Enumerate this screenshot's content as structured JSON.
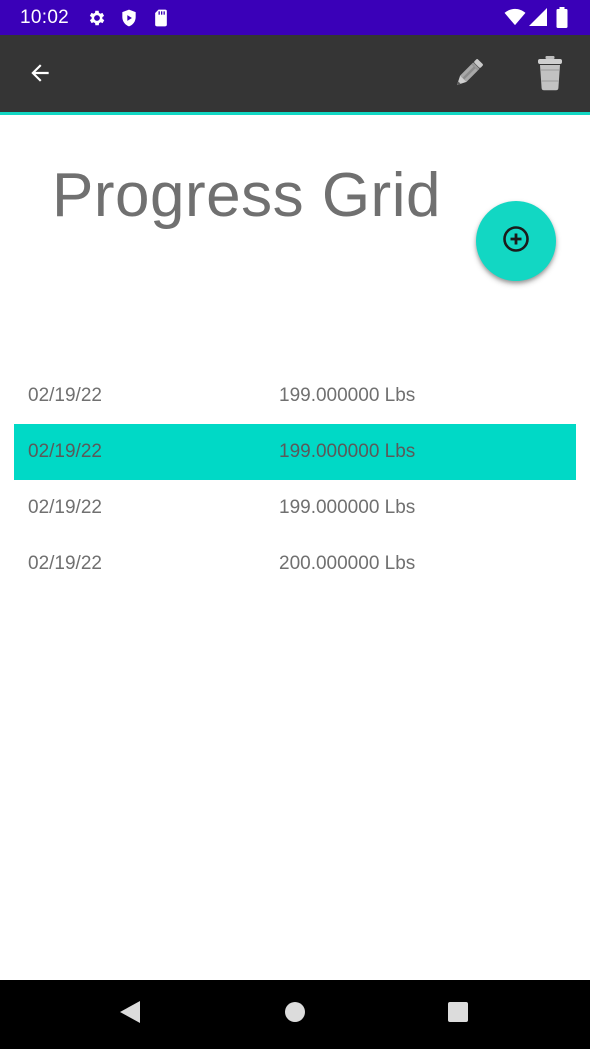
{
  "status_bar": {
    "time": "10:02",
    "background": "#3a00b8",
    "left_icons": [
      "gear-icon",
      "shield-play-icon",
      "sd-card-icon"
    ],
    "right_icons": [
      "wifi-icon",
      "cell-signal-icon",
      "battery-icon"
    ]
  },
  "toolbar": {
    "background": "#353535",
    "accent": "#12d7c3",
    "back_icon": "arrow-back-icon",
    "edit_icon": "pencil-icon",
    "delete_icon": "trash-icon"
  },
  "page": {
    "title": "Progress Grid"
  },
  "fab": {
    "icon": "plus-circle-icon",
    "color": "#12d7c3"
  },
  "entries": [
    {
      "date": "02/19/22",
      "weight": "199.000000 Lbs",
      "selected": false
    },
    {
      "date": "02/19/22",
      "weight": "199.000000 Lbs",
      "selected": true
    },
    {
      "date": "02/19/22",
      "weight": "199.000000 Lbs",
      "selected": false
    },
    {
      "date": "02/19/22",
      "weight": "200.000000 Lbs",
      "selected": false
    }
  ],
  "nav_bar": {
    "buttons": [
      "back-triangle-icon",
      "home-circle-icon",
      "recents-square-icon"
    ]
  }
}
